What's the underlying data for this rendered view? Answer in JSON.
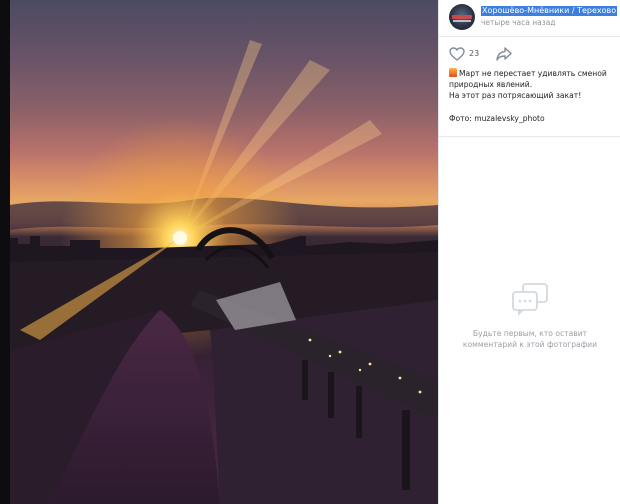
{
  "post": {
    "group_name": "Хорошёво-Мнёвники / Терехово",
    "time": "четыре часа назад",
    "likes": "23",
    "text_line1": "Март не перестает удивлять сменой",
    "text_line2": "природных явлений.",
    "text_line3": "На этот раз потрясающий закат!",
    "credit": "Фото: muzalevsky_photo"
  },
  "comments": {
    "empty_line1": "Будьте первым, кто оставит",
    "empty_line2": "комментарий к этой фотографии"
  },
  "icons": {
    "like": "heart-icon",
    "share": "share-arrow-icon",
    "comments": "speech-bubble-icon",
    "post_emoji": "fire-emoji-icon"
  },
  "colors": {
    "selection": "#3d7fe0",
    "muted_text": "#939699",
    "empty_text": "#9aa0a6"
  }
}
